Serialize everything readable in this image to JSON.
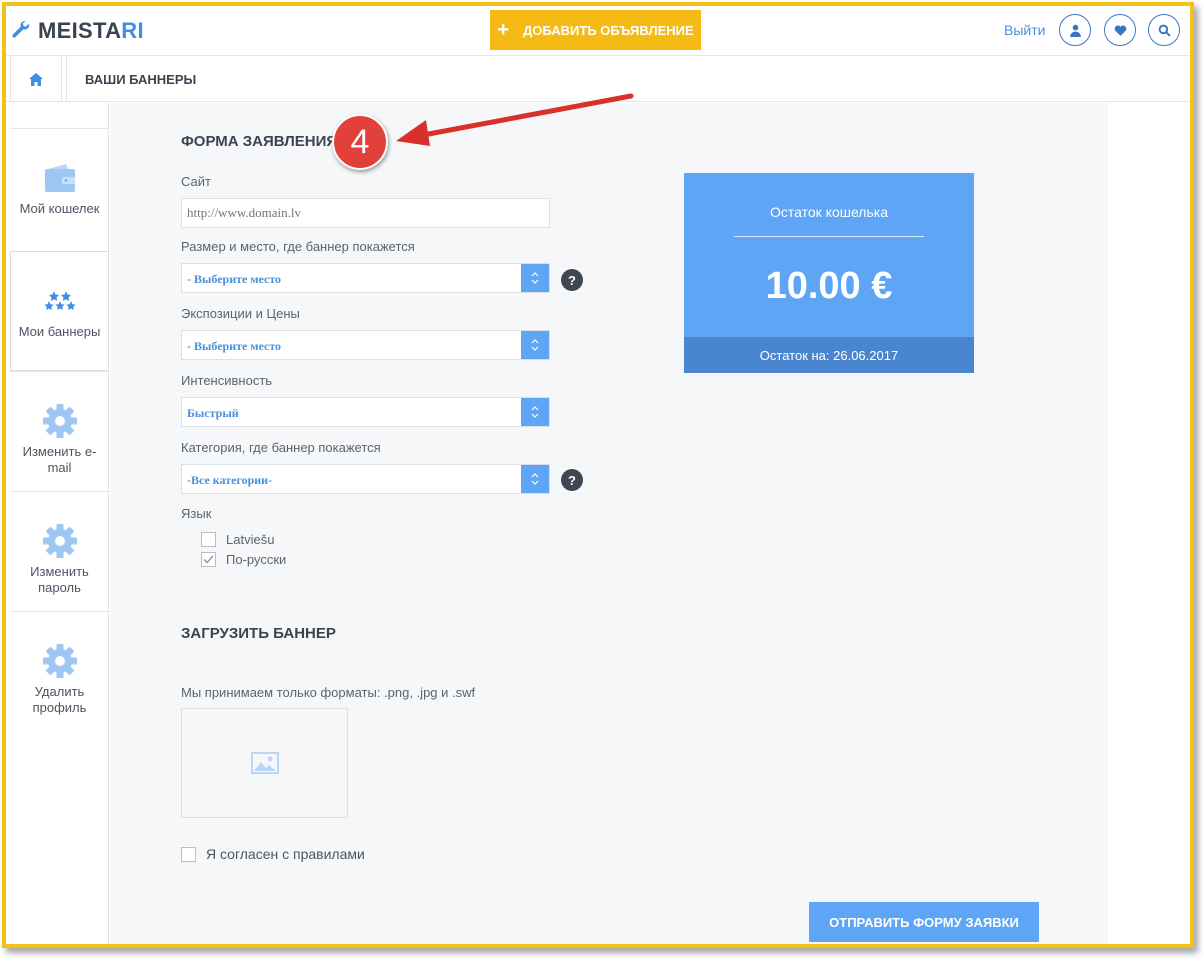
{
  "header": {
    "logo_main": "MEISTA",
    "logo_accent": "RI",
    "add_button_plus": "+",
    "add_button_label": "ДОБАВИТЬ ОБЪЯВЛЕНИЕ",
    "logout_label": "Выйти",
    "icons": [
      "user-icon",
      "heart-icon",
      "search-icon"
    ]
  },
  "breadcrumb": {
    "title": "ВАШИ БАННЕРЫ"
  },
  "sidebar": {
    "items": [
      {
        "label": "Мой кошелек",
        "icon": "wallet-icon"
      },
      {
        "label": "Мои баннеры",
        "icon": "stars-icon"
      },
      {
        "label": "Изменить e-mail",
        "icon": "gear-icon"
      },
      {
        "label": "Изменить пароль",
        "icon": "gear-icon"
      },
      {
        "label": "Удалить профиль",
        "icon": "gear-icon"
      }
    ]
  },
  "form": {
    "title": "ФОРМА ЗАЯВЛЕНИЯ",
    "site_label": "Сайт",
    "site_placeholder": "http://www.domain.lv",
    "size_label": "Размер и место, где баннер покажется",
    "size_value": "- Выберите место",
    "expo_label": "Экспозиции и Цены",
    "expo_value": "- Выберите место",
    "intensity_label": "Интенсивность",
    "intensity_value": "Быстрый",
    "category_label": "Категория, где баннер покажется",
    "category_value": "-Все категории-",
    "help_symbol": "?",
    "language_label": "Язык",
    "languages": [
      {
        "label": "Latviešu",
        "checked": false
      },
      {
        "label": "По-русски",
        "checked": true
      }
    ]
  },
  "upload": {
    "title": "ЗАГРУЗИТЬ БАННЕР",
    "formats_text": "Мы принимаем только форматы: .png, .jpg и .swf",
    "agree_label": "Я согласен с правилами",
    "submit_label": "ОТПРАВИТЬ ФОРМУ ЗАЯВКИ"
  },
  "wallet": {
    "title": "Остаток кошелька",
    "amount": "10.00 €",
    "footer": "Остаток на: 26.06.2017"
  },
  "annotation": {
    "number": "4"
  },
  "colors": {
    "accent_blue": "#5fa5f5",
    "brand_yellow": "#f5bb14",
    "annotation_red": "#e2403a"
  }
}
